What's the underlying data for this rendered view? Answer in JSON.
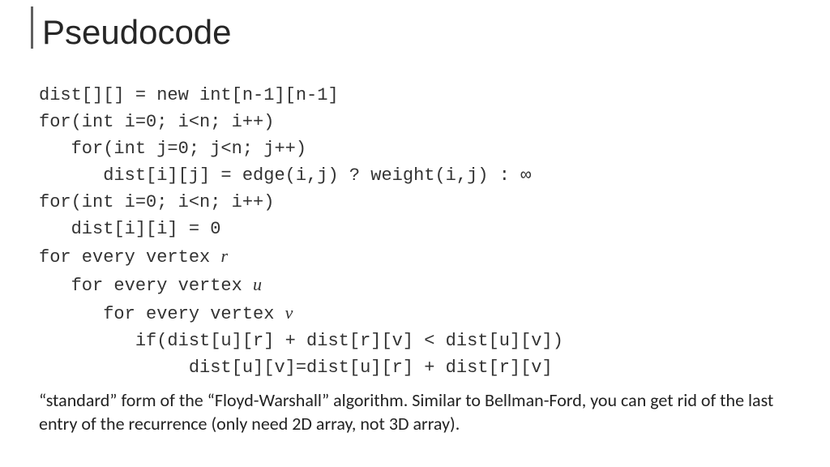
{
  "title": "Pseudocode",
  "code": {
    "l1": "dist[][] = new int[n-1][n-1]",
    "l2": "for(int i=0; i<n; i++)",
    "l3": "   for(int j=0; j<n; j++)",
    "l4": "      dist[i][j] = edge(i,j) ? weight(i,j) : ∞",
    "l5": "for(int i=0; i<n; i++)",
    "l6": "   dist[i][i] = 0",
    "l7a": "for every vertex ",
    "l7v": "r",
    "l8a": "   for every vertex ",
    "l8v": "u",
    "l9a": "      for every vertex ",
    "l9v": "v",
    "l10": "         if(dist[u][r] + dist[r][v] < dist[u][v])",
    "l11": "              dist[u][v]=dist[u][r] + dist[r][v]"
  },
  "note": "“standard” form of the “Floyd-Warshall” algorithm. Similar to Bellman-Ford, you can get rid of the last entry of the recurrence (only need 2D array, not 3D array)."
}
